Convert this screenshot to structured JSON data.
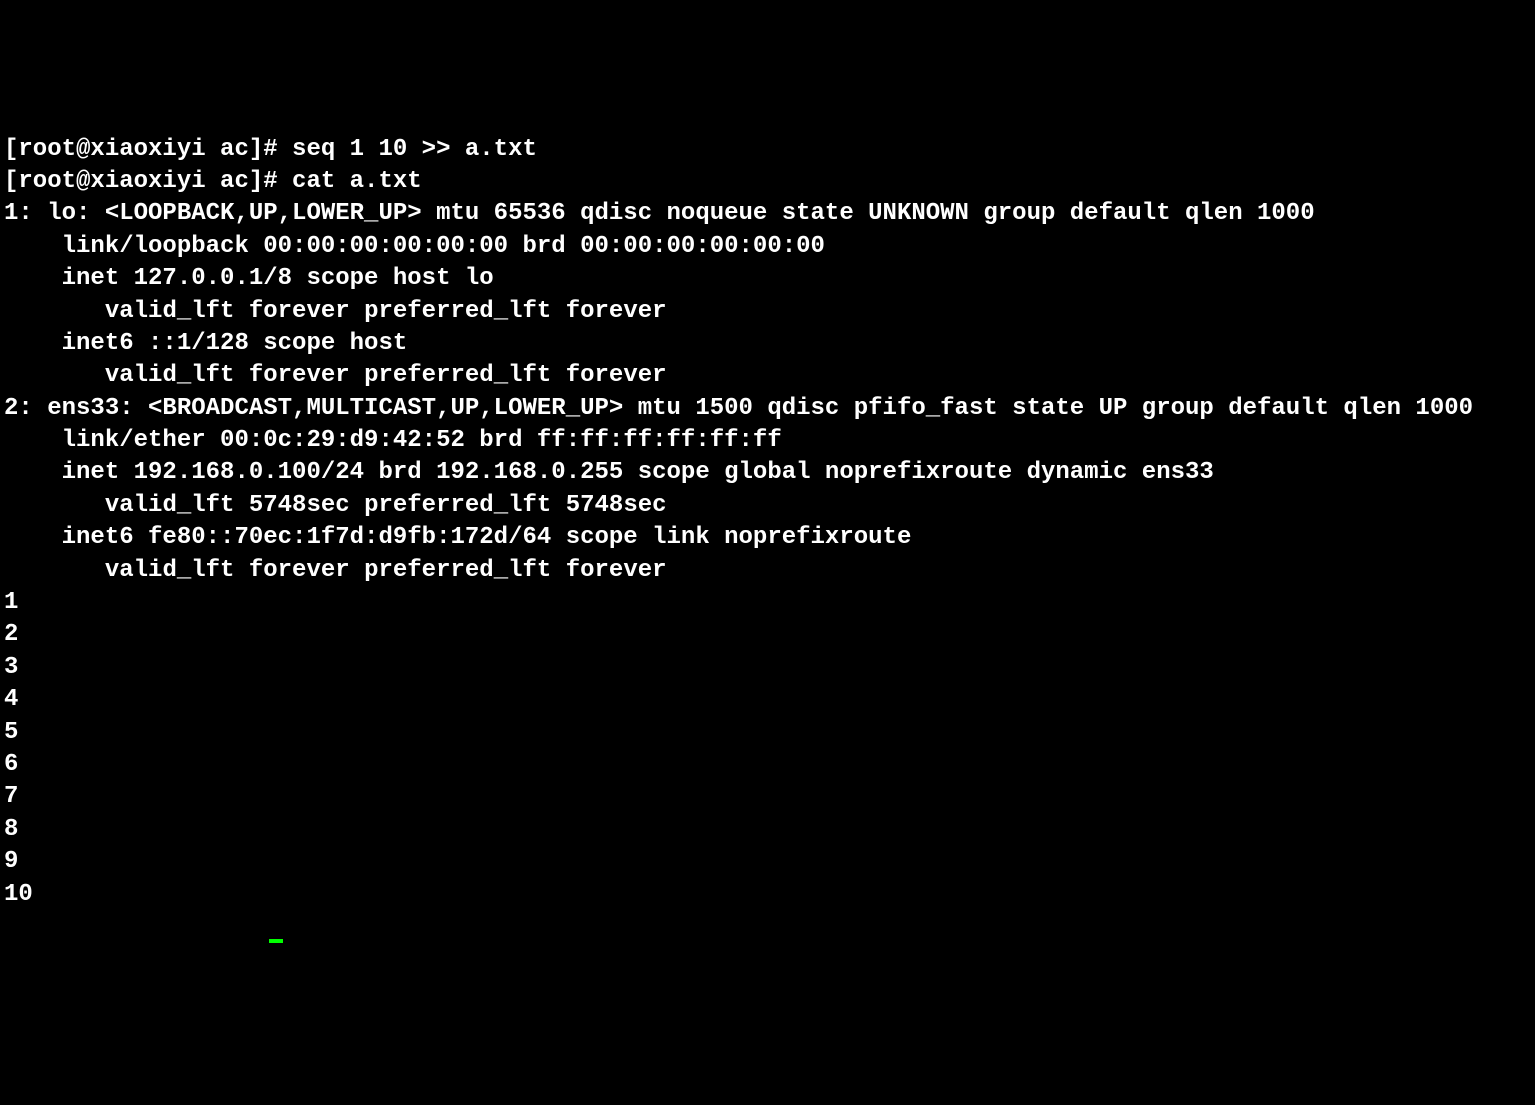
{
  "terminal": {
    "prompt": "[root@xiaoxiyi ac]# ",
    "commands": {
      "cmd1": "seq 1 10 >> a.txt",
      "cmd2": "cat a.txt"
    },
    "output": {
      "line1": "1: lo: <LOOPBACK,UP,LOWER_UP> mtu 65536 qdisc noqueue state UNKNOWN group default qlen 1000",
      "line2": "    link/loopback 00:00:00:00:00:00 brd 00:00:00:00:00:00",
      "line3": "    inet 127.0.0.1/8 scope host lo",
      "line4": "       valid_lft forever preferred_lft forever",
      "line5": "    inet6 ::1/128 scope host ",
      "line6": "       valid_lft forever preferred_lft forever",
      "line7": "2: ens33: <BROADCAST,MULTICAST,UP,LOWER_UP> mtu 1500 qdisc pfifo_fast state UP group default qlen 1000",
      "line8": "    link/ether 00:0c:29:d9:42:52 brd ff:ff:ff:ff:ff:ff",
      "line9": "    inet 192.168.0.100/24 brd 192.168.0.255 scope global noprefixroute dynamic ens33",
      "line10": "       valid_lft 5748sec preferred_lft 5748sec",
      "line11": "    inet6 fe80::70ec:1f7d:d9fb:172d/64 scope link noprefixroute ",
      "line12": "       valid_lft forever preferred_lft forever",
      "seq1": "1",
      "seq2": "2",
      "seq3": "3",
      "seq4": "4",
      "seq5": "5",
      "seq6": "6",
      "seq7": "7",
      "seq8": "8",
      "seq9": "9",
      "seq10": "10"
    }
  }
}
